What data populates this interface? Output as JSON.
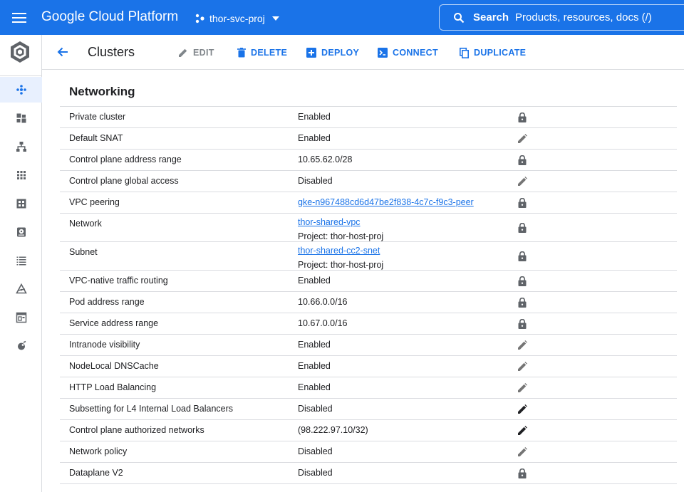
{
  "topbar": {
    "brand": "Google Cloud Platform",
    "project_name": "thor-svc-proj",
    "search_label": "Search",
    "search_placeholder": "Products, resources, docs (/)",
    "color": "#1a73e8"
  },
  "rail": {
    "items": [
      {
        "icon": "clusters-icon",
        "active": true
      },
      {
        "icon": "workloads-icon"
      },
      {
        "icon": "services-icon"
      },
      {
        "icon": "applications-icon"
      },
      {
        "icon": "configuration-icon"
      },
      {
        "icon": "storage-icon"
      },
      {
        "icon": "object-browser-icon"
      },
      {
        "icon": "migrate-icon"
      },
      {
        "icon": "marketplace-icon"
      },
      {
        "icon": "release-notes-icon"
      }
    ]
  },
  "actionbar": {
    "title": "Clusters",
    "actions": {
      "edit": "EDIT",
      "delete": "DELETE",
      "deploy": "DEPLOY",
      "connect": "CONNECT",
      "duplicate": "DUPLICATE"
    }
  },
  "networking": {
    "title": "Networking",
    "rows": [
      {
        "label": "Private cluster",
        "value": "Enabled",
        "icon": "lock-icon"
      },
      {
        "label": "Default SNAT",
        "value": "Enabled",
        "icon": "edit-icon"
      },
      {
        "label": "Control plane address range",
        "value": "10.65.62.0/28",
        "icon": "lock-icon"
      },
      {
        "label": "Control plane global access",
        "value": "Disabled",
        "icon": "edit-icon"
      },
      {
        "label": "VPC peering",
        "value": "gke-n967488cd6d47be2f838-4c7c-f9c3-peer",
        "icon": "lock-icon"
      },
      {
        "label": "Network",
        "value": "thor-shared-vpc",
        "sub": "Project: thor-host-proj",
        "icon": "lock-icon"
      },
      {
        "label": "Subnet",
        "value": "thor-shared-cc2-snet",
        "sub": "Project: thor-host-proj",
        "icon": "lock-icon"
      },
      {
        "label": "VPC-native traffic routing",
        "value": "Enabled",
        "icon": "lock-icon"
      },
      {
        "label": "Pod address range",
        "value": "10.66.0.0/16",
        "icon": "lock-icon"
      },
      {
        "label": "Service address range",
        "value": "10.67.0.0/16",
        "icon": "lock-icon"
      },
      {
        "label": "Intranode visibility",
        "value": "Enabled",
        "icon": "edit-icon"
      },
      {
        "label": "NodeLocal DNSCache",
        "value": "Enabled",
        "icon": "edit-icon"
      },
      {
        "label": "HTTP Load Balancing",
        "value": "Enabled",
        "icon": "edit-icon"
      },
      {
        "label": "Subsetting for L4 Internal Load Balancers",
        "value": "Disabled",
        "icon": "edit-icon-dark"
      },
      {
        "label": "Control plane authorized networks",
        "value": "(98.222.97.10/32)",
        "icon": "edit-icon-dark"
      },
      {
        "label": "Network policy",
        "value": "Disabled",
        "icon": "edit-icon"
      },
      {
        "label": "Dataplane V2",
        "value": "Disabled",
        "icon": "lock-icon"
      }
    ]
  }
}
